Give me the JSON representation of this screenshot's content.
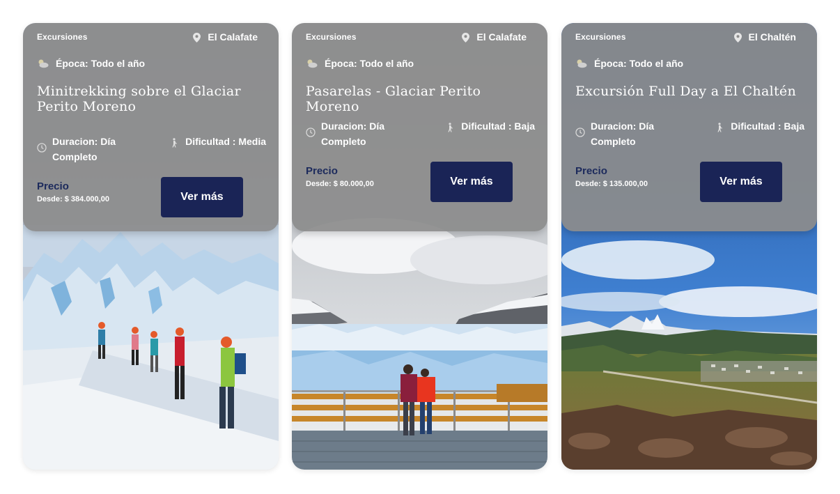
{
  "cards": [
    {
      "category": "Excursiones",
      "location": "El Calafate",
      "season": "Época: Todo el año",
      "title": "Minitrekking sobre el Glaciar Perito Moreno",
      "duration": "Duracion: Día Completo",
      "difficulty": "Dificultad : Media",
      "price_label": "Precio",
      "price": "Desde: $ 384.000,00",
      "button": "Ver más",
      "image": "glacier-hikers-photo"
    },
    {
      "category": "Excursiones",
      "location": "El Calafate",
      "season": "Época: Todo el año",
      "title": "Pasarelas - Glaciar Perito Moreno",
      "duration": "Duracion: Día Completo",
      "difficulty": "Dificultad : Baja",
      "price_label": "Precio",
      "price": "Desde: $ 80.000,00",
      "button": "Ver más",
      "image": "glacier-walkway-photo"
    },
    {
      "category": "Excursiones",
      "location": "El Chaltén",
      "season": "Época: Todo el año",
      "title": "Excursión Full Day a El Chaltén",
      "duration": "Duracion: Día Completo",
      "difficulty": "Dificultad : Baja",
      "price_label": "Precio",
      "price": "Desde: $ 135.000,00",
      "button": "Ver más",
      "image": "el-chalten-landscape-photo"
    }
  ],
  "colors": {
    "button_bg": "#1a2456",
    "price_label": "#1c2a5c",
    "overlay": "#8c8c8c"
  }
}
